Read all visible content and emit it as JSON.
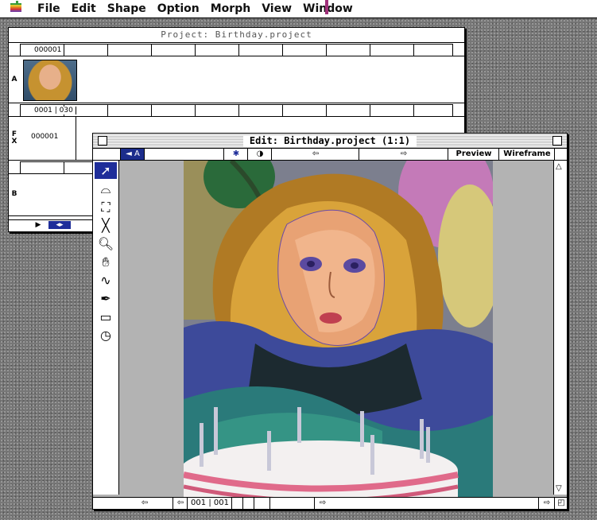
{
  "menubar": {
    "apple_icon": "apple-logo",
    "items": [
      "File",
      "Edit",
      "Shape",
      "Option",
      "Morph",
      "View",
      "Window"
    ]
  },
  "project_window": {
    "title": "Project: Birthday.project",
    "tracks": [
      {
        "letter": "",
        "ruler_label": "000001"
      },
      {
        "letter": "A",
        "ruler_label": ""
      },
      {
        "letter": "",
        "ruler_label": "0001 | 030"
      },
      {
        "letter": "F\nX",
        "ruler_label": "000001"
      },
      {
        "letter": "",
        "ruler_label": ""
      },
      {
        "letter": "B",
        "ruler_label": ""
      }
    ],
    "fx_label": "000001"
  },
  "edit_window": {
    "title": "Edit: Birthday.project  (1:1)",
    "toolbar": {
      "nav_left": "◄ A",
      "preview_label": "Preview",
      "wireframe_label": "Wireframe"
    },
    "frame_counter": "001 | 001",
    "tools": [
      "pointer",
      "lasso",
      "crop",
      "line",
      "magnifier",
      "hand",
      "curve",
      "pen",
      "rectangle",
      "timer"
    ]
  },
  "colors": {
    "desktop": "#777777",
    "selection_blue": "#1f2e9a"
  }
}
